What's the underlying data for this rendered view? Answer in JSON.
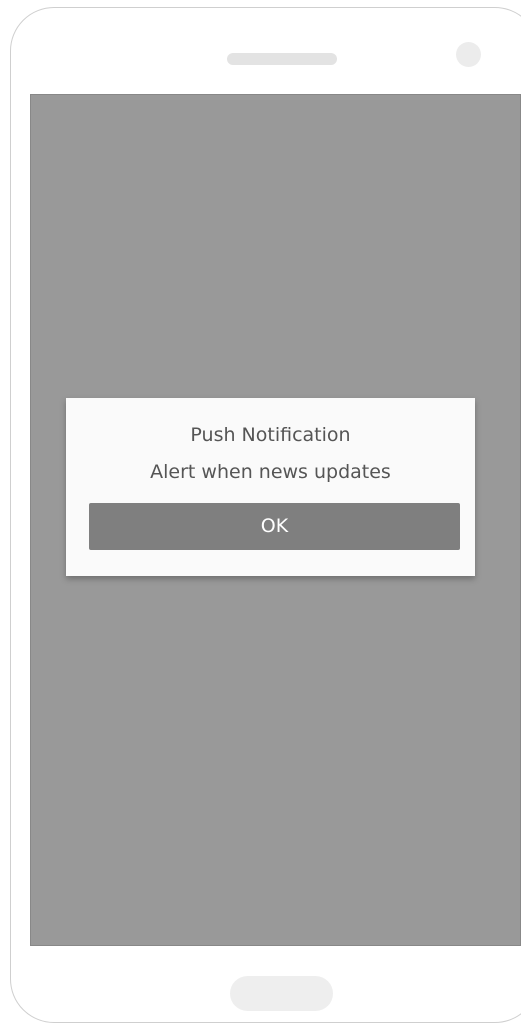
{
  "dialog": {
    "title": "Push Notification",
    "message": "Alert when news updates",
    "ok_label": "OK"
  },
  "colors": {
    "screen_overlay": "#999999",
    "dialog_background": "#fafafa",
    "button_background": "#7f7f7f",
    "button_text": "#ffffff",
    "dialog_text": "#555555"
  }
}
